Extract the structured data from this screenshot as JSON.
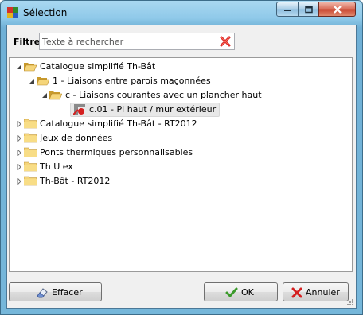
{
  "window": {
    "title": "Sélection",
    "controls": [
      "minimize-icon",
      "maximize-icon",
      "close-icon"
    ]
  },
  "filter": {
    "label": "Filtre",
    "placeholder": "Texte à rechercher",
    "value": "",
    "clear_icon": "clear-x-icon",
    "clear_color": "#d42020"
  },
  "tree": {
    "nodes": [
      {
        "label": "Catalogue simplifié Th-Bât",
        "level": 0,
        "expanded": true
      },
      {
        "label": "1 - Liaisons entre parois maçonnées",
        "level": 1,
        "expanded": true
      },
      {
        "label": "c - Liaisons courantes avec un plancher haut",
        "level": 2,
        "expanded": true
      },
      {
        "label": "c.01 - Pl haut / mur extérieur",
        "level": 3,
        "selected": true
      },
      {
        "label": "Catalogue simplifié Th-Bât - RT2012",
        "level": 0,
        "expanded": false
      },
      {
        "label": "Jeux de données",
        "level": 0,
        "expanded": false
      },
      {
        "label": "Ponts thermiques personnalisables",
        "level": 0,
        "expanded": false
      },
      {
        "label": "Th U ex",
        "level": 0,
        "expanded": false
      },
      {
        "label": "Th-Bât - RT2012",
        "level": 0,
        "expanded": false
      }
    ]
  },
  "buttons": {
    "clear": {
      "label": "Effacer",
      "icon": "eraser-icon"
    },
    "ok": {
      "label": "OK",
      "icon": "checkmark-icon",
      "color": "#3a9a2a"
    },
    "cancel": {
      "label": "Annuler",
      "icon": "x-icon",
      "color": "#d42020"
    }
  }
}
